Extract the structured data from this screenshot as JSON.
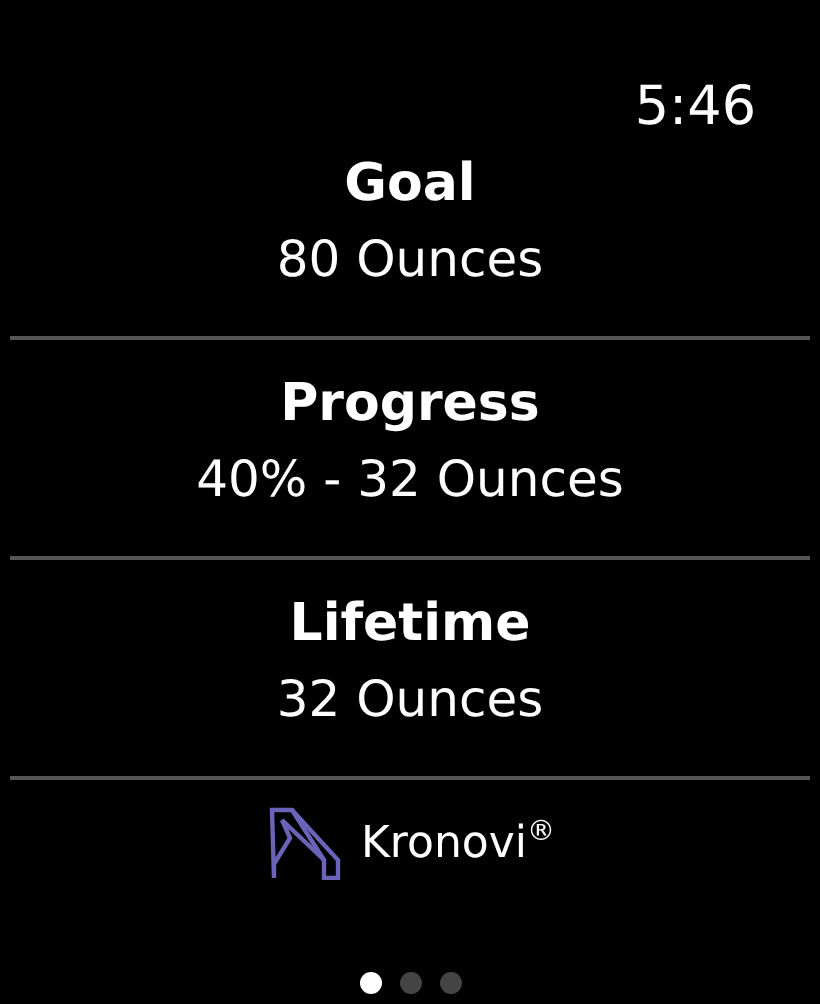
{
  "status_bar": {
    "time": "5:46"
  },
  "stats": [
    {
      "title": "Goal",
      "value": "80 Ounces"
    },
    {
      "title": "Progress",
      "value": "40% - 32 Ounces"
    },
    {
      "title": "Lifetime",
      "value": "32 Ounces"
    }
  ],
  "brand": {
    "name": "Kronovi$^{®}$"
  },
  "page_dots": [
    {
      "selected": true
    },
    {
      "selected": false
    },
    {
      "selected": false
    }
  ]
}
